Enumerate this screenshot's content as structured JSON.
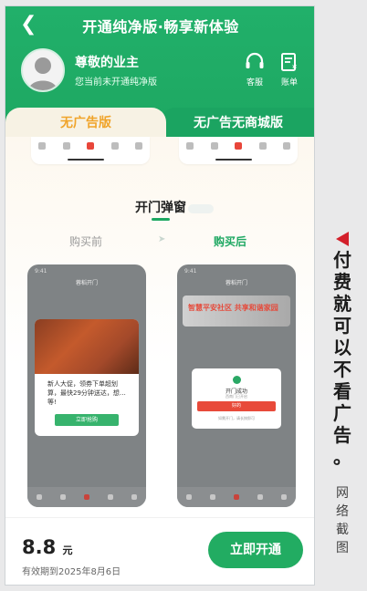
{
  "header": {
    "title": "开通纯净版·畅享新体验",
    "user_name": "尊敬的业主",
    "user_status": "您当前未开通纯净版",
    "service_label": "客服",
    "bill_label": "账单"
  },
  "tabs": [
    {
      "label": "无广告版"
    },
    {
      "label": "无广告无商城版"
    }
  ],
  "section": {
    "title": "开门弹窗",
    "before_label": "购买前",
    "after_label": "购买后"
  },
  "mock_before": {
    "status": "9:41",
    "title": "蓉稻开门",
    "popup_text": "新人大促，领券下单超划算，最快29分钟送达，想…等!",
    "popup_button": "立即抢购"
  },
  "mock_after": {
    "status": "9:41",
    "title": "蓉稻开门",
    "banner_text": "智慧平安社区 共享和谐家园",
    "popup_title": "开门成功",
    "popup_sub": "西南门已开启",
    "popup_button": "好的",
    "popup_note": "如需开门，请长按即可"
  },
  "footer": {
    "price": "8.8",
    "unit": "元",
    "validity": "有效期到2025年8月6日",
    "buy_button": "立即开通"
  },
  "caption": {
    "main": [
      "付",
      "费",
      "就",
      "可",
      "以",
      "不",
      "看",
      "广",
      "告",
      "。"
    ],
    "sub": [
      "网",
      "络",
      "截",
      "图"
    ]
  },
  "colors": {
    "brand_green": "#1ea862",
    "accent_orange": "#f0a42a",
    "caption_red": "#d3202b"
  }
}
